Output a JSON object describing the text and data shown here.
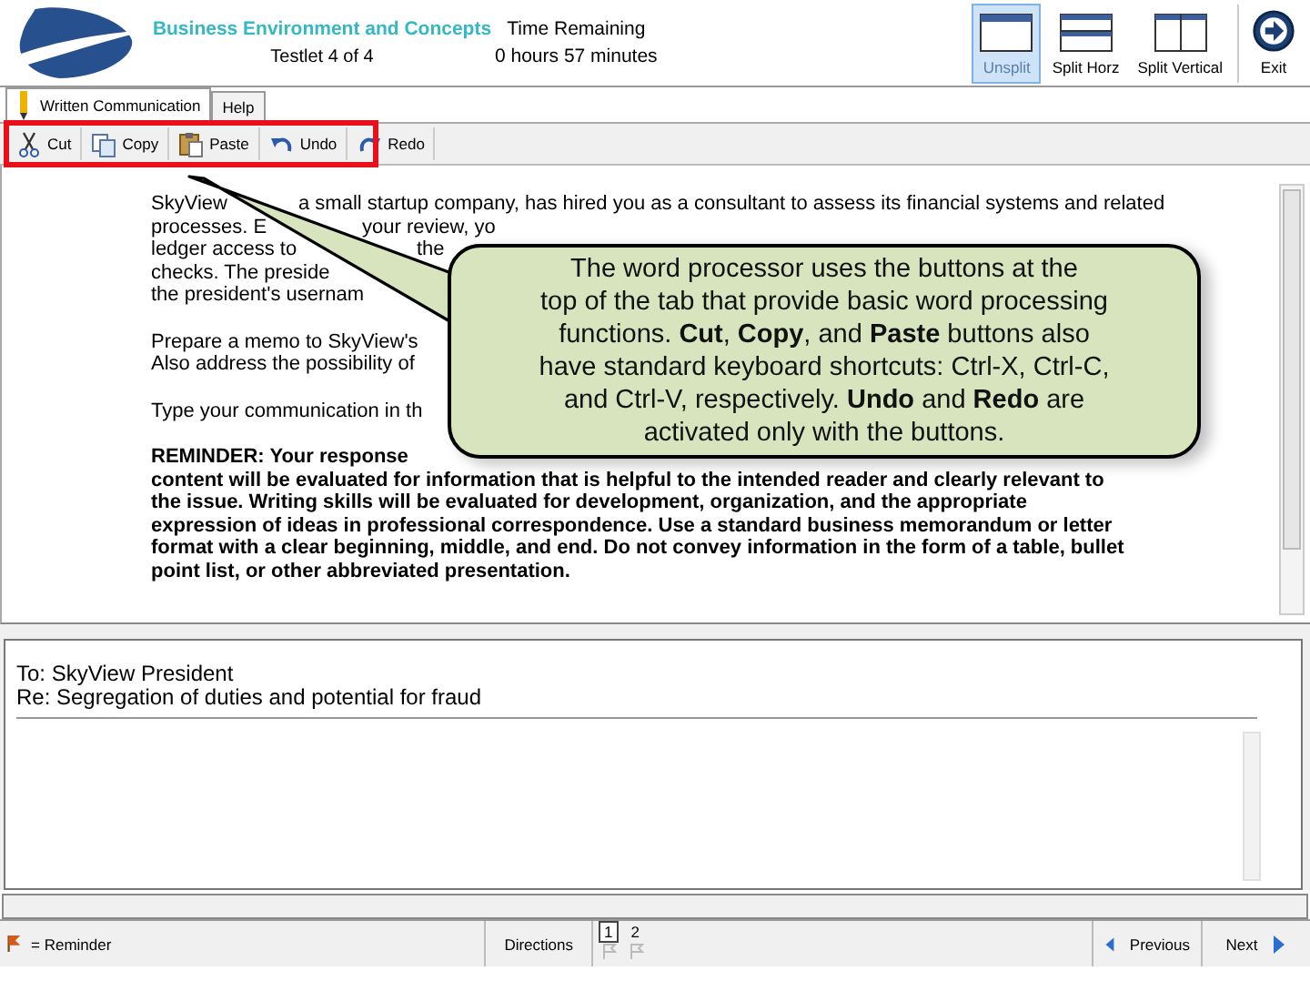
{
  "header": {
    "subject": "Business Environment and Concepts",
    "testlet": "Testlet 4 of 4",
    "time_label": "Time Remaining",
    "time_value": "0 hours 57 minutes"
  },
  "view_buttons": [
    {
      "label": "Unsplit",
      "kind": "unsplit",
      "selected": true
    },
    {
      "label": "Split Horz",
      "kind": "horizontal",
      "selected": false
    },
    {
      "label": "Split Vertical",
      "kind": "vertical",
      "selected": false
    }
  ],
  "exit_button": {
    "label": "Exit"
  },
  "tabs": [
    {
      "label": "Written Communication",
      "selected": true,
      "kind": "pencil"
    },
    {
      "label": "Help",
      "selected": false,
      "kind": "plain"
    }
  ],
  "toolbar": [
    {
      "label": "Cut",
      "kind": "cut"
    },
    {
      "label": "Copy",
      "kind": "copy"
    },
    {
      "label": "Paste",
      "kind": "paste"
    },
    {
      "label": "Undo",
      "kind": "undo"
    },
    {
      "label": "Redo",
      "kind": "redo"
    }
  ],
  "passage": [
    {
      "bold": false,
      "lines": [
        [
          "SkyView",
          "a small startup company, has hired you as a consultant to assess its financial systems and related"
        ],
        [
          "processes. E",
          "your review, yo"
        ],
        [
          "ledger access to",
          "the"
        ],
        [
          "checks. The preside"
        ],
        [
          "the president's usernam"
        ]
      ]
    },
    {
      "bold": false,
      "lines": [
        [
          "Prepare a memo to SkyView's"
        ],
        [
          "Also address the possibility of"
        ]
      ]
    },
    {
      "bold": false,
      "lines": [
        [
          "Type your communication in th"
        ]
      ]
    },
    {
      "bold": true,
      "lines": [
        [
          "REMINDER: Your response"
        ],
        [
          "content will be evaluated for information that is helpful to the intended reader and clearly relevant to"
        ],
        [
          "the issue. Writing skills will be evaluated for development, organization, and the appropriate"
        ],
        [
          "expression of ideas in professional correspondence. Use a standard business memorandum or letter"
        ],
        [
          "format with a clear beginning, middle, and end. Do not convey information in the form of a table, bullet"
        ],
        [
          "point list, or other abbreviated presentation."
        ]
      ]
    }
  ],
  "callout": {
    "lines": [
      "The word processor uses the buttons at the",
      "top of the tab that provide basic word processing",
      "functions. **Cut**, **Copy**, and **Paste** buttons also",
      "have standard keyboard shortcuts: Ctrl-X, Ctrl-C,",
      "and Ctrl-V, respectively. **Undo** and **Redo** are",
      "activated only with the buttons."
    ]
  },
  "answer": {
    "lines": [
      "To: SkyView President",
      "Re: Segregation of duties and potential for fraud"
    ]
  },
  "footer": {
    "legend": "= Reminder",
    "directions": "Directions",
    "pages": [
      {
        "label": "1",
        "selected": true
      },
      {
        "label": "2",
        "selected": false
      }
    ],
    "previous": "Previous",
    "next": "Next"
  }
}
